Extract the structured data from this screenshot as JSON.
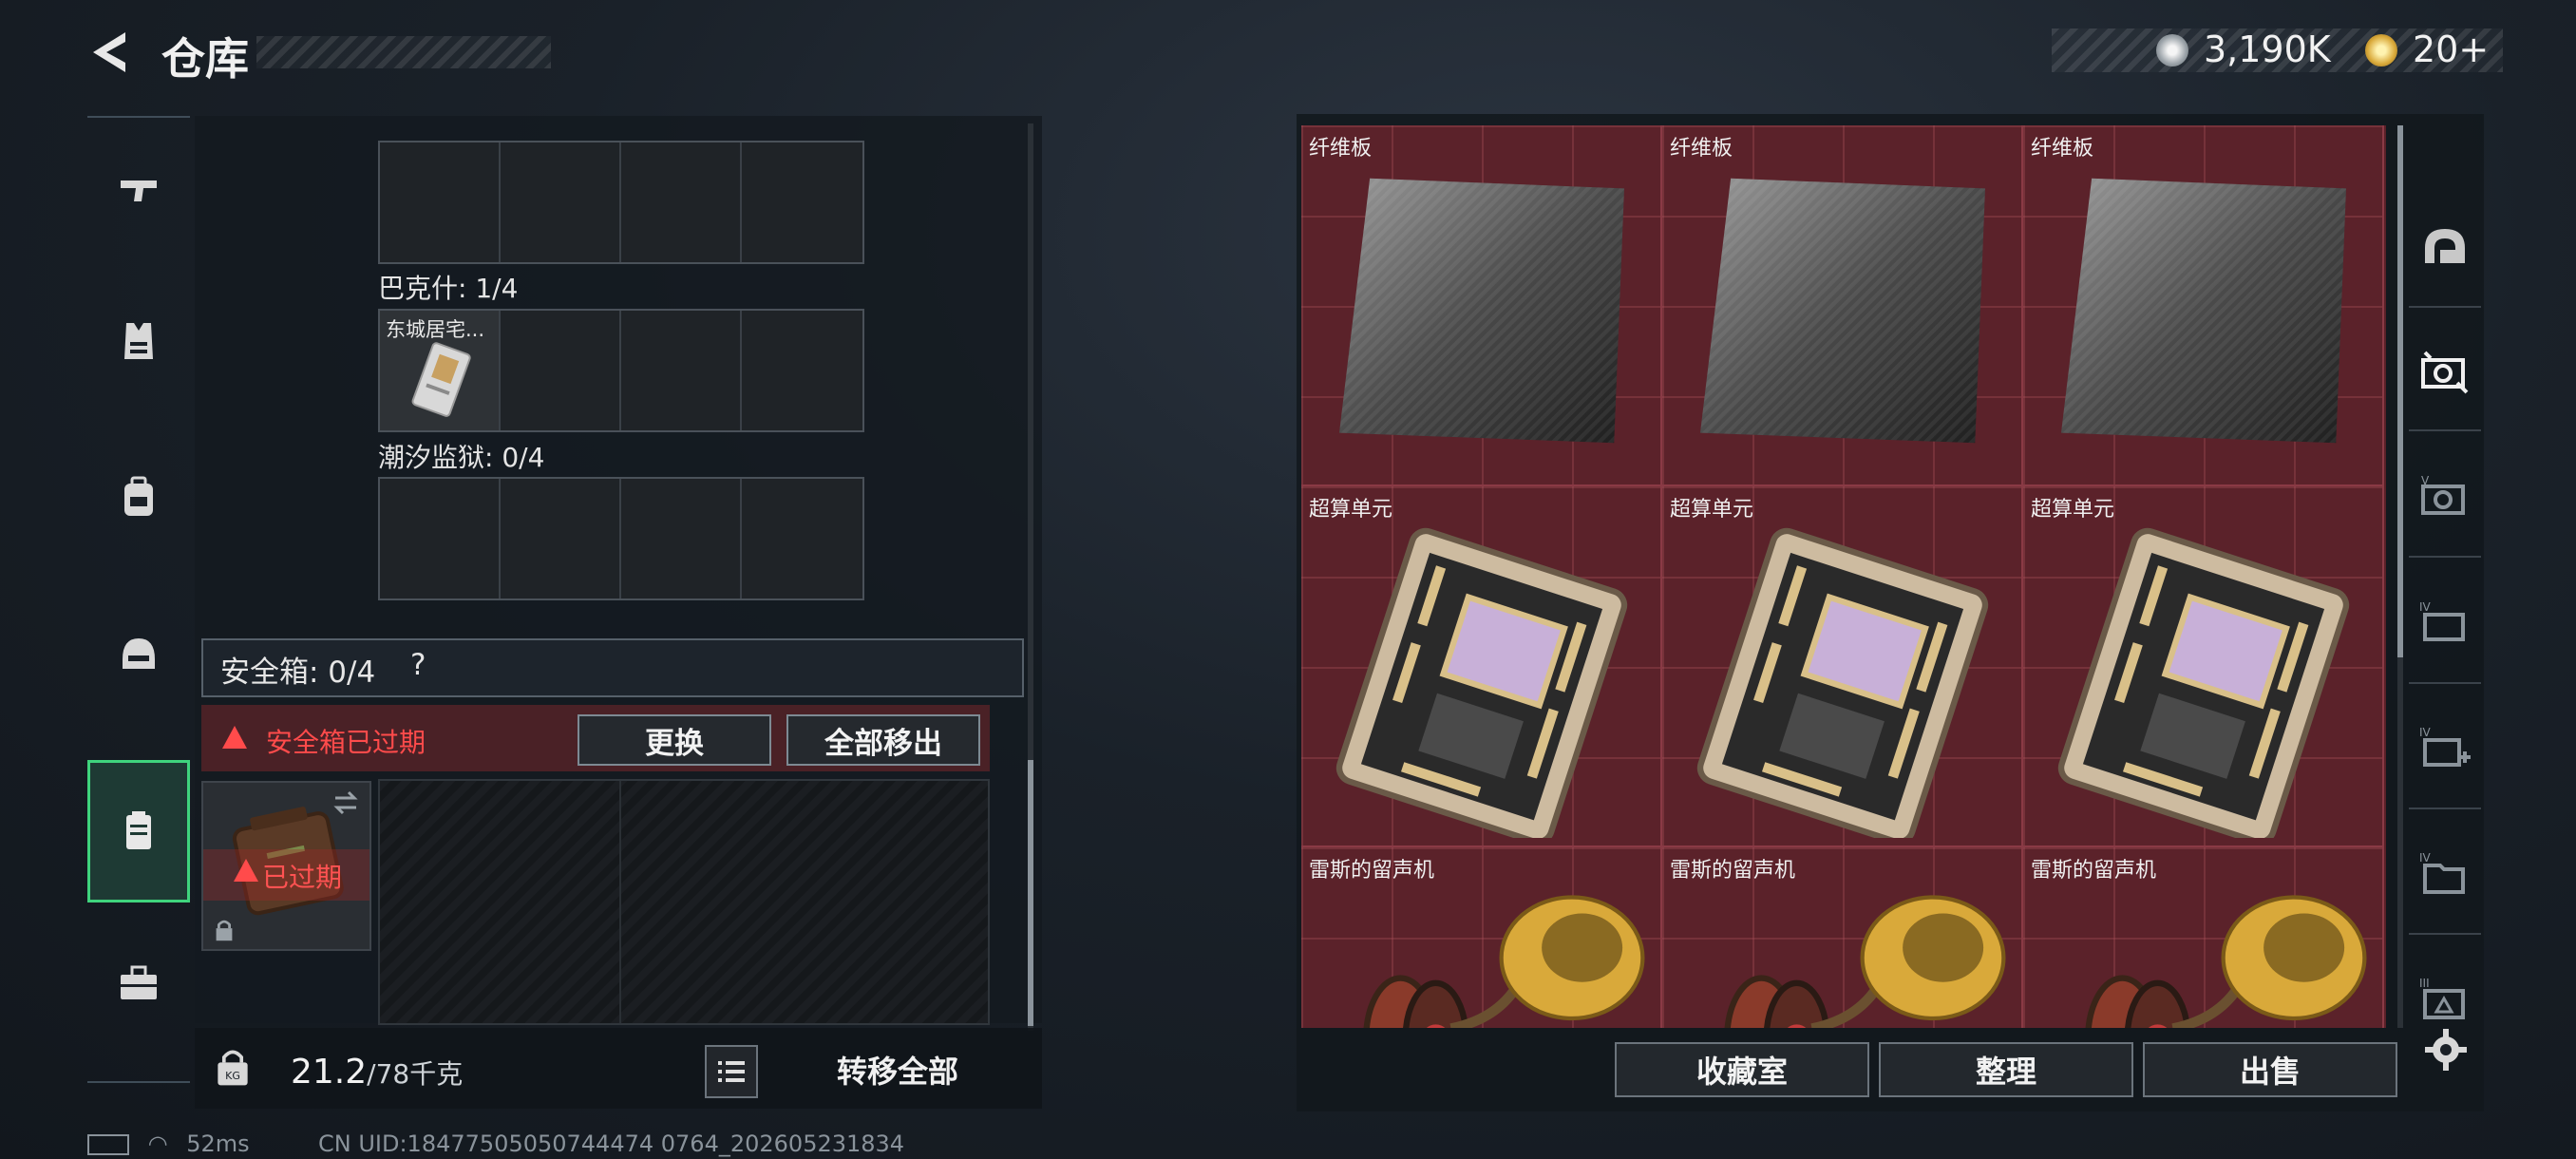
{
  "header": {
    "title": "仓库",
    "currency_1": "3,190K",
    "currency_2": "20+"
  },
  "left_rail": {
    "items": [
      {
        "name": "weapons",
        "icon": "gun-icon"
      },
      {
        "name": "armor",
        "icon": "vest-icon"
      },
      {
        "name": "backpack",
        "icon": "backpack-icon"
      },
      {
        "name": "helmet",
        "icon": "helmet-icon"
      },
      {
        "name": "safe-box",
        "icon": "case-icon",
        "active": true
      },
      {
        "name": "toolkit",
        "icon": "briefcase-icon"
      }
    ]
  },
  "storage_groups": [
    {
      "label": "巴克什: 1/4",
      "items": [
        {
          "label": "东城居宅..."
        }
      ]
    },
    {
      "label": "潮汐监狱: 0/4",
      "items": []
    }
  ],
  "safe_box": {
    "label": "安全箱: 0/4",
    "help": "?",
    "expired_text": "安全箱已过期",
    "replace_label": "更换",
    "move_all_label": "全部移出",
    "case_status": "已过期"
  },
  "footer_left": {
    "weight": "21.2",
    "weight_unit": "/78千克",
    "transfer_all_label": "转移全部"
  },
  "status": {
    "ping": "52ms",
    "uid": "CN UID:18477505050744474 0764_202605231834"
  },
  "grid_items": [
    {
      "label": "纤维板",
      "type": "fiberboard"
    },
    {
      "label": "纤维板",
      "type": "fiberboard"
    },
    {
      "label": "纤维板",
      "type": "fiberboard"
    },
    {
      "label": "超算单元",
      "type": "circuit"
    },
    {
      "label": "超算单元",
      "type": "circuit"
    },
    {
      "label": "超算单元",
      "type": "circuit"
    },
    {
      "label": "雷斯的留声机",
      "type": "gramophone"
    },
    {
      "label": "雷斯的留声机",
      "type": "gramophone"
    },
    {
      "label": "雷斯的留声机",
      "type": "gramophone"
    }
  ],
  "right_rail": {
    "items": [
      "helmet-outline-icon",
      "storage-1-icon",
      "storage-2-icon",
      "storage-3-icon",
      "storage-4-icon",
      "storage-5-icon",
      "storage-6-icon"
    ],
    "settings_icon": "gear-icon"
  },
  "footer_right": {
    "collection_label": "收藏室",
    "organize_label": "整理",
    "sell_label": "出售"
  }
}
